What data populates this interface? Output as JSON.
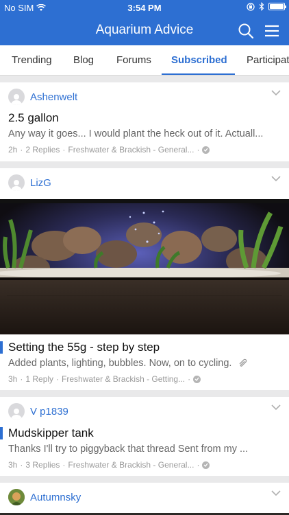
{
  "status_bar": {
    "carrier": "No SIM",
    "time": "3:54 PM",
    "battery_level": 1.0
  },
  "header": {
    "title": "Aquarium Advice"
  },
  "tabs": [
    {
      "label": "Trending"
    },
    {
      "label": "Blog"
    },
    {
      "label": "Forums"
    },
    {
      "label": "Subscribed",
      "active": true
    },
    {
      "label": "Participat"
    }
  ],
  "feed": [
    {
      "author": "Ashenwelt",
      "title": "2.5 gallon",
      "snippet": "Any way it goes... I would plant the heck out of it. Actuall...",
      "meta": {
        "age": "2h",
        "replies": "2 Replies",
        "forum": "Freshwater & Brackish - General..."
      }
    },
    {
      "author": "LizG",
      "title": "Setting the 55g - step by step",
      "snippet": "Added plants, lighting, bubbles. Now, on to cycling.",
      "meta": {
        "age": "3h",
        "replies": "1 Reply",
        "forum": "Freshwater & Brackish - Getting..."
      }
    },
    {
      "author": "V p1839",
      "title": "Mudskipper tank",
      "snippet": "Thanks I'll try to piggyback that thread Sent from my ...",
      "meta": {
        "age": "3h",
        "replies": "3 Replies",
        "forum": "Freshwater & Brackish - General..."
      }
    },
    {
      "author": "Autumnsky"
    }
  ],
  "colors": {
    "brand": "#2d6fd2",
    "background": "#e9e9ea",
    "meta_text": "#999999"
  }
}
